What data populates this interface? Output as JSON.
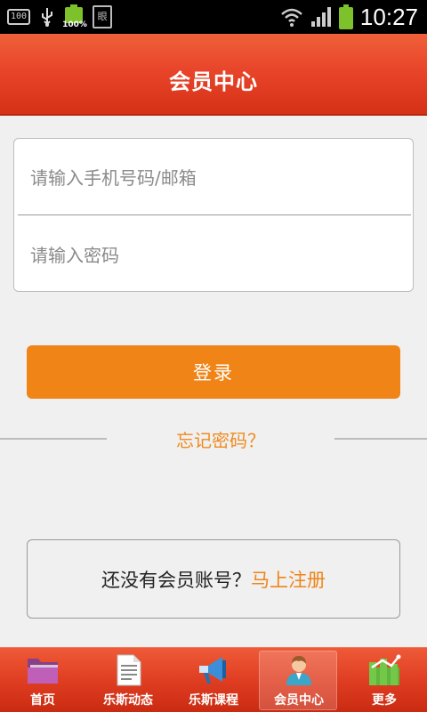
{
  "status_bar": {
    "time": "10:27",
    "battery_small_text": "100%",
    "box_icon_text": "100",
    "doc_icon_text": "眼"
  },
  "header": {
    "title": "会员中心"
  },
  "login_form": {
    "phone_placeholder": "请输入手机号码/邮箱",
    "password_placeholder": "请输入密码",
    "login_label": "登录",
    "forgot_label": "忘记密码？"
  },
  "register": {
    "prompt": "还没有会员账号？",
    "link": "马上注册"
  },
  "tabs": [
    {
      "label": "首页",
      "icon": "folder-icon",
      "active": false
    },
    {
      "label": "乐斯动态",
      "icon": "document-icon",
      "active": false
    },
    {
      "label": "乐斯课程",
      "icon": "megaphone-icon",
      "active": false
    },
    {
      "label": "会员中心",
      "icon": "member-icon",
      "active": true
    },
    {
      "label": "更多",
      "icon": "more-icon",
      "active": false
    }
  ],
  "colors": {
    "accent": "#f08417",
    "header_red": "#e8452a",
    "background": "#f0f0f0"
  }
}
